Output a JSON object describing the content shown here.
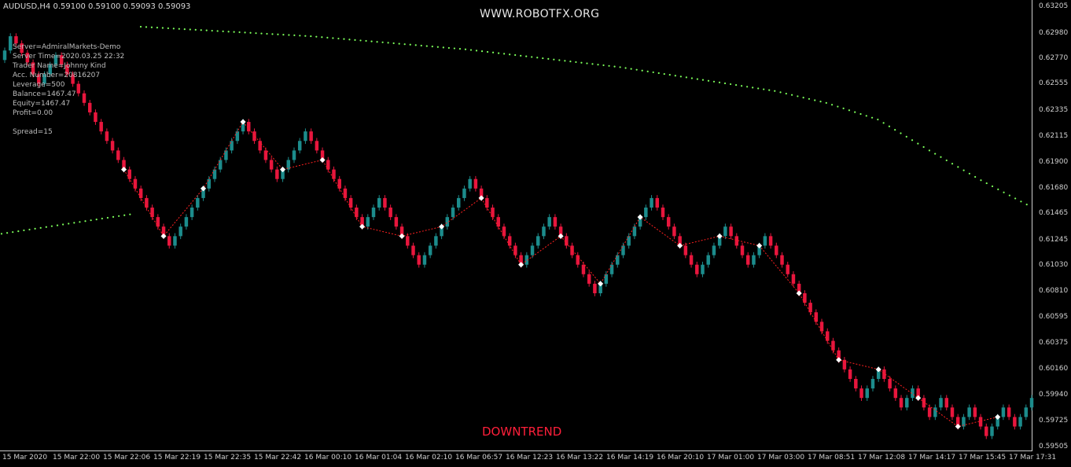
{
  "header": {
    "symbol_line": "AUDUSD,H4  0.59100 0.59100 0.59093 0.59093",
    "site": "WWW.ROBOTFX.ORG"
  },
  "account_info": [
    "Server=AdmiralMarkets-Demo",
    "Server Time=2020.03.25 22:32",
    "Trader Name=Johnny Kind",
    "Acc. Number=20816207",
    "Leverage=500",
    "Balance=1467.47",
    "Equity=1467.47",
    "Profit=0.00",
    "",
    "Spread=15"
  ],
  "trend_label": "DOWNTREND",
  "colors": {
    "background": "#000000",
    "bull": "#1c8c8c",
    "bear": "#e8163d",
    "ma_dots": "#7cff5a",
    "zigzag": "#ff2020",
    "axis_text": "#d0d0d0"
  },
  "chart_data": {
    "type": "candlestick",
    "title": "",
    "ylim": [
      0.59505,
      0.63205
    ],
    "y_ticks": [
      "0.63205",
      "0.62980",
      "0.62770",
      "0.62555",
      "0.62335",
      "0.62115",
      "0.61900",
      "0.61680",
      "0.61465",
      "0.61245",
      "0.61030",
      "0.60810",
      "0.60595",
      "0.60375",
      "0.60160",
      "0.59940",
      "0.59725",
      "0.59505"
    ],
    "x_ticks": [
      "15 Mar 2020",
      "15 Mar 22:00",
      "15 Mar 22:06",
      "15 Mar 22:19",
      "15 Mar 22:35",
      "15 Mar 22:42",
      "16 Mar 00:10",
      "16 Mar 01:04",
      "16 Mar 02:10",
      "16 Mar 06:57",
      "16 Mar 12:23",
      "16 Mar 13:22",
      "16 Mar 14:19",
      "16 Mar 20:10",
      "17 Mar 01:00",
      "17 Mar 03:00",
      "17 Mar 08:51",
      "17 Mar 12:08",
      "17 Mar 14:17",
      "17 Mar 15:45",
      "17 Mar 17:31"
    ],
    "closes": [
      0.6284,
      0.6296,
      0.629,
      0.6282,
      0.6274,
      0.6264,
      0.6256,
      0.6264,
      0.6272,
      0.628,
      0.6272,
      0.6264,
      0.6256,
      0.6248,
      0.624,
      0.6232,
      0.6224,
      0.6216,
      0.6208,
      0.62,
      0.6192,
      0.6184,
      0.6176,
      0.6168,
      0.616,
      0.6152,
      0.6144,
      0.6136,
      0.6128,
      0.612,
      0.6128,
      0.6136,
      0.6144,
      0.6152,
      0.616,
      0.6168,
      0.6176,
      0.6184,
      0.6192,
      0.62,
      0.6208,
      0.6216,
      0.6224,
      0.6216,
      0.6208,
      0.62,
      0.6192,
      0.6184,
      0.6176,
      0.6184,
      0.6192,
      0.62,
      0.6208,
      0.6216,
      0.6208,
      0.62,
      0.6192,
      0.6184,
      0.6176,
      0.6168,
      0.616,
      0.6152,
      0.6144,
      0.6136,
      0.6144,
      0.6152,
      0.616,
      0.6152,
      0.6144,
      0.6136,
      0.6128,
      0.612,
      0.6112,
      0.6104,
      0.6112,
      0.612,
      0.6128,
      0.6136,
      0.6144,
      0.6152,
      0.616,
      0.6168,
      0.6176,
      0.6168,
      0.616,
      0.6152,
      0.6144,
      0.6136,
      0.6128,
      0.612,
      0.6112,
      0.6104,
      0.6112,
      0.612,
      0.6128,
      0.6136,
      0.6144,
      0.6136,
      0.6128,
      0.612,
      0.6112,
      0.6104,
      0.6096,
      0.6088,
      0.608,
      0.6088,
      0.6096,
      0.6104,
      0.6112,
      0.612,
      0.6128,
      0.6136,
      0.6144,
      0.6152,
      0.616,
      0.6152,
      0.6144,
      0.6136,
      0.6128,
      0.612,
      0.6112,
      0.6104,
      0.6096,
      0.6104,
      0.6112,
      0.612,
      0.6128,
      0.6136,
      0.6128,
      0.612,
      0.6112,
      0.6104,
      0.6112,
      0.612,
      0.6128,
      0.612,
      0.6112,
      0.6104,
      0.6096,
      0.6088,
      0.608,
      0.6072,
      0.6064,
      0.6056,
      0.6048,
      0.604,
      0.6032,
      0.6024,
      0.6016,
      0.6008,
      0.6,
      0.5992,
      0.6,
      0.6008,
      0.6016,
      0.6008,
      0.6,
      0.5992,
      0.5984,
      0.5992,
      0.6,
      0.5992,
      0.5984,
      0.5976,
      0.5984,
      0.5992,
      0.5984,
      0.5976,
      0.5968,
      0.5976,
      0.5984,
      0.5976,
      0.5968,
      0.596,
      0.5968,
      0.5976,
      0.5984,
      0.5976,
      0.5968,
      0.5976,
      0.5984,
      0.5992
    ],
    "ma_series": [
      {
        "x_frac": [
          0.0,
          0.13
        ],
        "y": [
          0.613,
          0.6147
        ]
      },
      {
        "x_frac": [
          0.135,
          0.3,
          0.45,
          0.6,
          0.75,
          0.8,
          0.85,
          0.9,
          0.95,
          1.0
        ],
        "y": [
          0.6304,
          0.6296,
          0.6285,
          0.627,
          0.625,
          0.624,
          0.6226,
          0.62,
          0.6175,
          0.6152
        ]
      }
    ]
  }
}
